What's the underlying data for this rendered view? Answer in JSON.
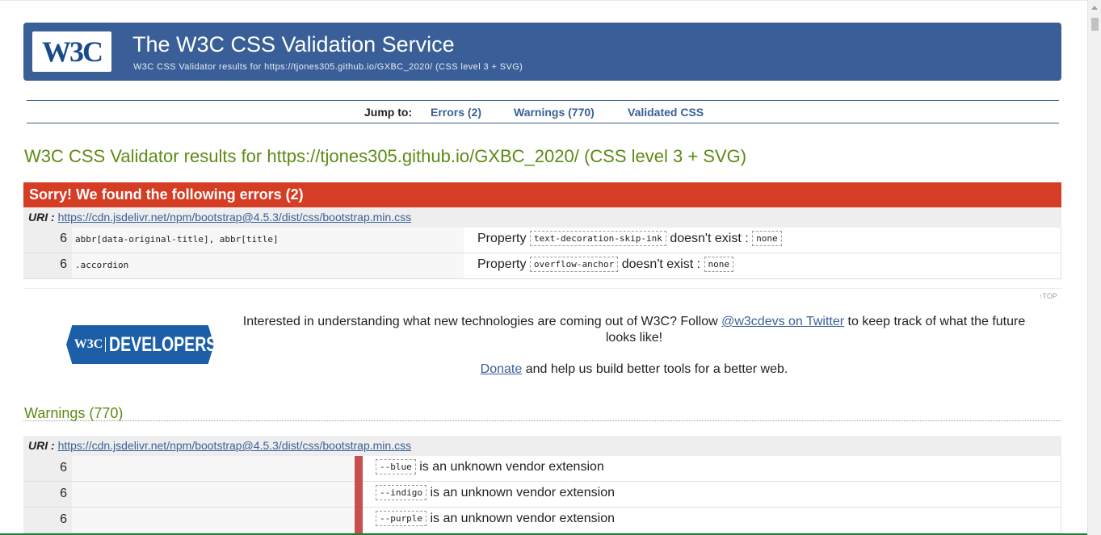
{
  "banner": {
    "logo_text": "W3C",
    "title": "The W3C CSS Validation Service",
    "subtitle": "W3C CSS Validator results for https://tjones305.github.io/GXBC_2020/ (CSS level 3 + SVG)"
  },
  "jump": {
    "label": "Jump to:",
    "links": [
      "Errors (2)",
      "Warnings (770)",
      "Validated CSS"
    ]
  },
  "results_title": "W3C CSS Validator results for https://tjones305.github.io/GXBC_2020/ (CSS level 3 + SVG)",
  "errors": {
    "header": "Sorry! We found the following errors (2)",
    "uri_label": "URI :",
    "uri": "https://cdn.jsdelivr.net/npm/bootstrap@4.5.3/dist/css/bootstrap.min.css",
    "rows": [
      {
        "line": "6",
        "context": "abbr[data-original-title], abbr[title]",
        "prefix": "Property",
        "property": "text-decoration-skip-ink",
        "middle": "doesn't exist :",
        "value": "none"
      },
      {
        "line": "6",
        "context": ".accordion",
        "prefix": "Property",
        "property": "overflow-anchor",
        "middle": "doesn't exist :",
        "value": "none"
      }
    ]
  },
  "top_link": "↑TOP",
  "developers": {
    "logo_w3c": "W3C",
    "logo_text": "DEVELOPERS",
    "promo_before": "Interested in understanding what new technologies are coming out of W3C? Follow ",
    "promo_link": "@w3cdevs on Twitter",
    "promo_after": " to keep track of what the future looks like!",
    "donate_link": "Donate",
    "donate_after": " and help us build better tools for a better web."
  },
  "warnings": {
    "title": "Warnings (770)",
    "uri_label": "URI :",
    "uri": "https://cdn.jsdelivr.net/npm/bootstrap@4.5.3/dist/css/bootstrap.min.css",
    "rows": [
      {
        "line": "6",
        "code": "--blue",
        "message": "is an unknown vendor extension"
      },
      {
        "line": "6",
        "code": "--indigo",
        "message": "is an unknown vendor extension"
      },
      {
        "line": "6",
        "code": "--purple",
        "message": "is an unknown vendor extension"
      }
    ]
  },
  "colors": {
    "banner": "#3a5f98",
    "error_header": "#d53d24",
    "title_green": "#5e8a14",
    "link_blue": "#3a5f98"
  }
}
